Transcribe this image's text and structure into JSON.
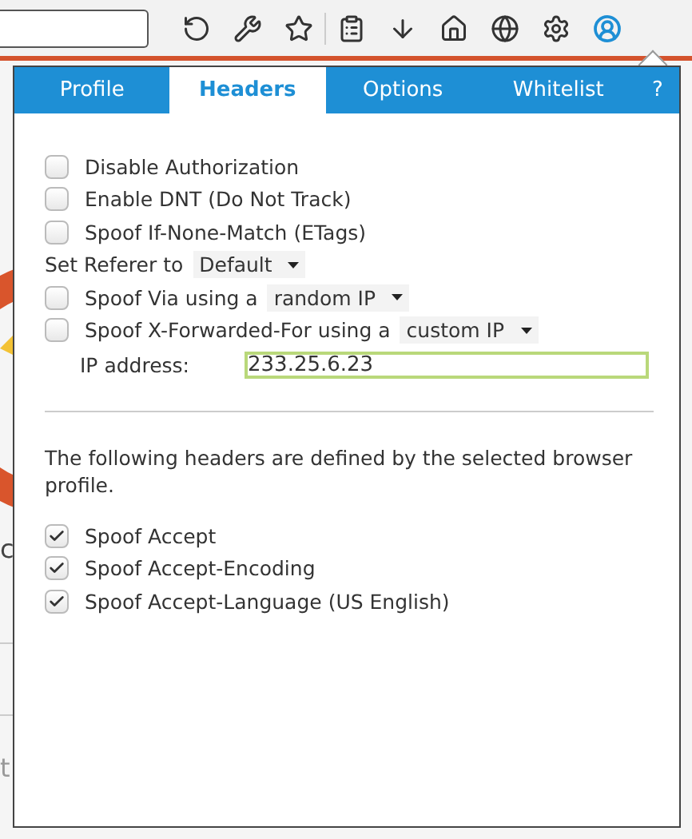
{
  "background_text": [
    "c",
    "t"
  ],
  "tabs": [
    {
      "label": "Profile",
      "selected": false
    },
    {
      "label": "Headers",
      "selected": true
    },
    {
      "label": "Options",
      "selected": false
    },
    {
      "label": "Whitelist",
      "selected": false
    },
    {
      "label": "?",
      "selected": false
    }
  ],
  "options": [
    {
      "kind": "checkbox",
      "label": "Disable Authorization",
      "checked": false
    },
    {
      "kind": "checkbox",
      "label": "Enable DNT (Do Not Track)",
      "checked": false
    },
    {
      "kind": "checkbox",
      "label": "Spoof If-None-Match (ETags)",
      "checked": false
    },
    {
      "kind": "select",
      "label": "Set Referer to",
      "value": "Default"
    },
    {
      "kind": "checkbox_select",
      "label": "Spoof Via using a",
      "value": "random IP",
      "checked": false
    },
    {
      "kind": "checkbox_select",
      "label": "Spoof X-Forwarded-For using a",
      "value": "custom IP",
      "checked": false
    },
    {
      "kind": "text_input",
      "label": "IP address:",
      "value": "233.25.6.23"
    }
  ],
  "profile_note": "The following headers are defined by the selected browser profile.",
  "profile_headers": [
    {
      "label": "Spoof Accept",
      "checked": true
    },
    {
      "label": "Spoof Accept-Encoding",
      "checked": true
    },
    {
      "label": "Spoof Accept-Language (US English)",
      "checked": true
    }
  ]
}
